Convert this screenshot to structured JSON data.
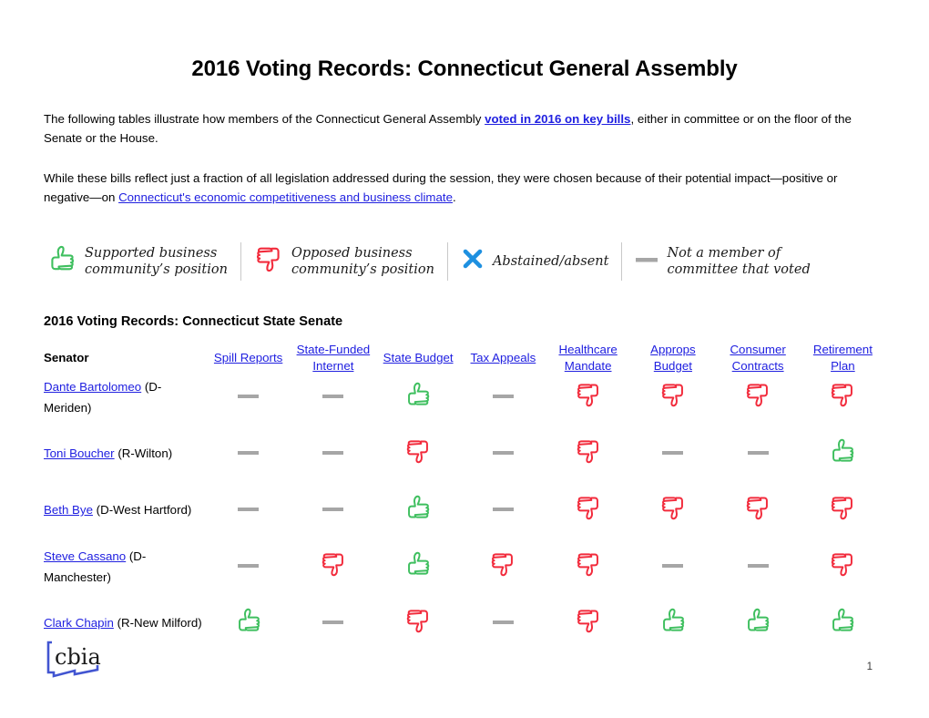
{
  "document": {
    "title": "2016 Voting Records: Connecticut General Assembly",
    "page_number": "1"
  },
  "intro": {
    "p1_before": "The following tables illustrate how members of the Connecticut General Assembly ",
    "p1_link": "voted in 2016 on key bills",
    "p1_after": ", either in committee or on the floor of the Senate or the House.",
    "p2_before": "While these bills reflect just a fraction of all legislation addressed during the session, they were chosen because of their potential impact—positive or negative—on ",
    "p2_link": "Connecticut's economic competitiveness and business climate",
    "p2_after": "."
  },
  "legend": {
    "items": [
      {
        "icon": "thumbs-up-icon",
        "label": "Supported business\ncommunity’s position"
      },
      {
        "icon": "thumbs-down-icon",
        "label": "Opposed business\ncommunity’s position"
      },
      {
        "icon": "x-mark-icon",
        "label": "Abstained/absent"
      },
      {
        "icon": "dash-icon",
        "label": "Not a member of\ncommittee that voted"
      }
    ]
  },
  "section": {
    "heading": "2016 Voting Records: Connecticut State Senate"
  },
  "table": {
    "senator_header": "Senator",
    "columns": [
      "Spill Reports",
      "State-Funded Internet",
      "State Budget",
      "Tax Appeals",
      "Healthcare Mandate",
      "Approps Budget",
      "Consumer Contracts",
      "Retirement Plan"
    ],
    "rows": [
      {
        "name": "Dante Bartolomeo",
        "affiliation": " (D-Meriden)",
        "votes": [
          "none",
          "none",
          "up",
          "none",
          "down",
          "down",
          "down",
          "down"
        ]
      },
      {
        "name": "Toni Boucher",
        "affiliation": " (R-Wilton)",
        "votes": [
          "none",
          "none",
          "down",
          "none",
          "down",
          "none",
          "none",
          "up"
        ]
      },
      {
        "name": "Beth Bye",
        "affiliation": " (D-West Hartford)",
        "votes": [
          "none",
          "none",
          "up",
          "none",
          "down",
          "down",
          "down",
          "down"
        ]
      },
      {
        "name": "Steve Cassano",
        "affiliation": " (D-Manchester)",
        "votes": [
          "none",
          "down",
          "up",
          "down",
          "down",
          "none",
          "none",
          "down"
        ]
      },
      {
        "name": "Clark Chapin",
        "affiliation": " (R-New Milford)",
        "votes": [
          "up",
          "none",
          "down",
          "none",
          "down",
          "up",
          "up",
          "up"
        ]
      }
    ]
  },
  "colors": {
    "support_green": "#3FBF5F",
    "oppose_red": "#F22B3C",
    "not_member_gray": "#A6A6A6",
    "abstain_blue": "#1E90E0",
    "link_blue": "#2020E0",
    "logo_blue": "#4255D1"
  },
  "logo": {
    "text": "cbia",
    "shape": "connecticut-outline-icon"
  }
}
